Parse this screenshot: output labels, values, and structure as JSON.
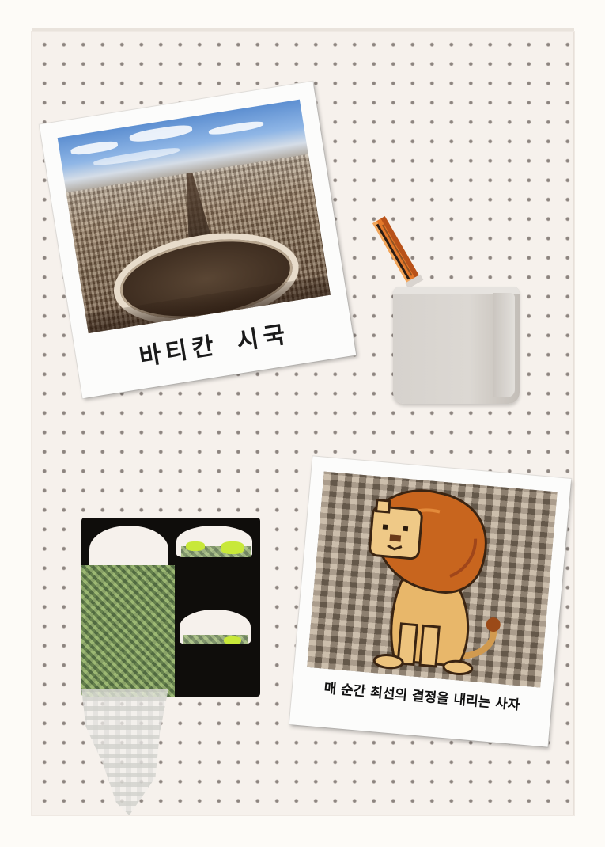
{
  "polaroid_vatican": {
    "caption": "바티칸 시국"
  },
  "polaroid_lion": {
    "caption": "매 순간 최선의 결정을 내리는 사자"
  },
  "colors": {
    "pegboard": "#f6f1ec",
    "peg_hole": "#8d8580",
    "polaroid_frame": "#fcfcfb",
    "shelf": "#0f0d0b",
    "moss": "#7a9a5a",
    "moss_highlight": "#c8e83a",
    "pen_cup": "#d6d2cd",
    "lion_mane": "#c8651e",
    "lion_body": "#e8b76a"
  },
  "icons": {
    "pen": "pen-icon",
    "pen_cup": "pen-cup-icon",
    "plant_shelf": "hanging-plant-shelf-icon",
    "lion": "lion-icon"
  }
}
